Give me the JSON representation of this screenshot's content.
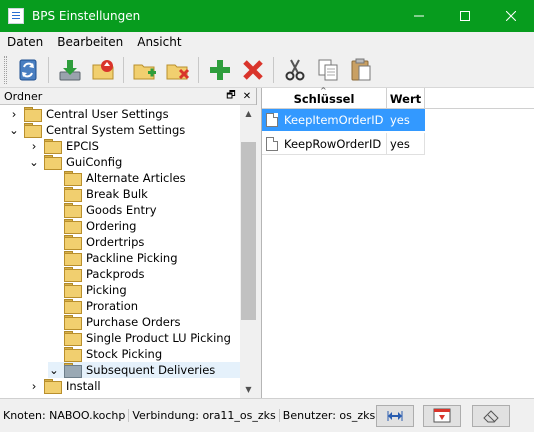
{
  "window": {
    "title": "BPS Einstellungen",
    "minimize": "—",
    "maximize": "☐",
    "close": "✕"
  },
  "menu": {
    "items": [
      "Daten",
      "Bearbeiten",
      "Ansicht"
    ]
  },
  "toolbar": {
    "buttons": [
      "refresh-icon",
      "import-icon",
      "export-icon",
      "new-folder-icon",
      "delete-folder-icon",
      "add-icon",
      "delete-icon",
      "cut-icon",
      "copy-icon",
      "paste-icon"
    ]
  },
  "left_panel": {
    "title": "Ordner",
    "pin": "🗗",
    "close": "✕",
    "tree": [
      {
        "label": "Central User Settings",
        "level": 0,
        "toggle": "›"
      },
      {
        "label": "Central System Settings",
        "level": 0,
        "toggle": "⌄"
      },
      {
        "label": "EPCIS",
        "level": 1,
        "toggle": "›"
      },
      {
        "label": "GuiConfig",
        "level": 1,
        "toggle": "⌄"
      },
      {
        "label": "Alternate Articles",
        "level": 2,
        "toggle": ""
      },
      {
        "label": "Break Bulk",
        "level": 2,
        "toggle": ""
      },
      {
        "label": "Goods Entry",
        "level": 2,
        "toggle": ""
      },
      {
        "label": "Ordering",
        "level": 2,
        "toggle": ""
      },
      {
        "label": "Ordertrips",
        "level": 2,
        "toggle": ""
      },
      {
        "label": "Packline Picking",
        "level": 2,
        "toggle": ""
      },
      {
        "label": "Packprods",
        "level": 2,
        "toggle": ""
      },
      {
        "label": "Picking",
        "level": 2,
        "toggle": ""
      },
      {
        "label": "Proration",
        "level": 2,
        "toggle": ""
      },
      {
        "label": "Purchase Orders",
        "level": 2,
        "toggle": ""
      },
      {
        "label": "Single Product LU Picking",
        "level": 2,
        "toggle": ""
      },
      {
        "label": "Stock Picking",
        "level": 2,
        "toggle": ""
      },
      {
        "label": "Subsequent Deliveries",
        "level": 2,
        "toggle": "⌄",
        "selected": true
      },
      {
        "label": "Install",
        "level": 1,
        "toggle": "›"
      }
    ]
  },
  "right_panel": {
    "columns": [
      "Schlüssel",
      "Wert"
    ],
    "rows": [
      {
        "key": "KeepItemOrderID",
        "value": "yes",
        "selected": true
      },
      {
        "key": "KeepRowOrderID",
        "value": "yes",
        "selected": false
      }
    ]
  },
  "status": {
    "node": "Knoten: NABOO.kochp",
    "connection": "Verbindung: ora11_os_zks",
    "user": "Benutzer: os_zks"
  },
  "colors": {
    "titlebar": "#079c1e",
    "selection": "#3399ff"
  }
}
